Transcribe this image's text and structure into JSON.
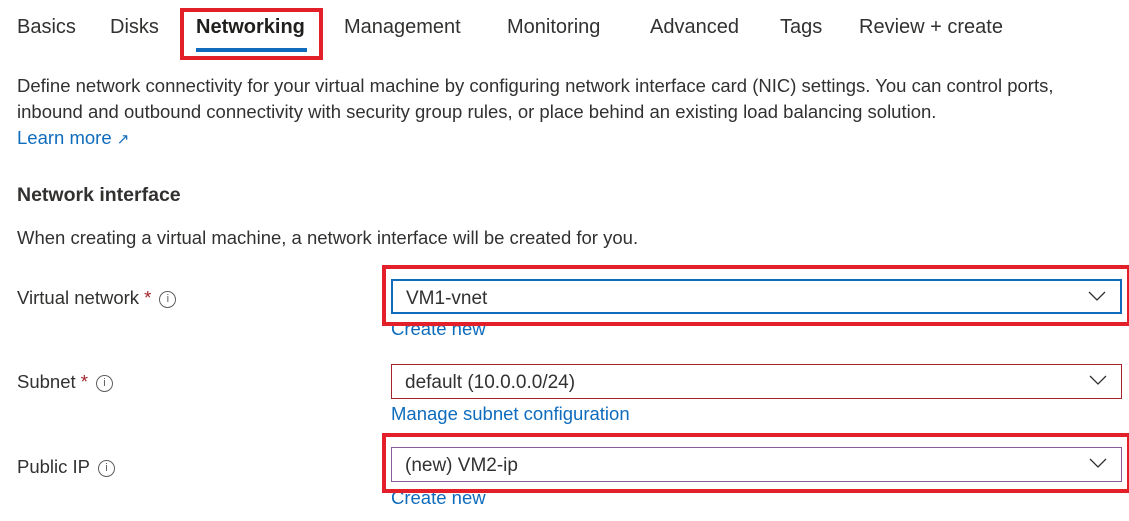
{
  "tabs": [
    {
      "label": "Basics"
    },
    {
      "label": "Disks"
    },
    {
      "label": "Networking",
      "active": true
    },
    {
      "label": "Management"
    },
    {
      "label": "Monitoring"
    },
    {
      "label": "Advanced"
    },
    {
      "label": "Tags"
    },
    {
      "label": "Review + create"
    }
  ],
  "description": {
    "line1": "Define network connectivity for your virtual machine by configuring network interface card (NIC) settings. You can control ports,",
    "line2": "inbound and outbound connectivity with security group rules, or place behind an existing load balancing solution.",
    "learn_more": "Learn more"
  },
  "section": {
    "title": "Network interface",
    "subtitle": "When creating a virtual machine, a network interface will be created for you."
  },
  "fields": {
    "virtual_network": {
      "label": "Virtual network",
      "required": "*",
      "value": "VM1-vnet",
      "link": "Create new"
    },
    "subnet": {
      "label": "Subnet",
      "required": "*",
      "value": "default (10.0.0.0/24)",
      "link": "Manage subnet configuration"
    },
    "public_ip": {
      "label": "Public IP",
      "value": "(new) VM2-ip",
      "link": "Create new"
    }
  },
  "colors": {
    "highlight": "#e3202a",
    "accent": "#0f6cbd"
  }
}
